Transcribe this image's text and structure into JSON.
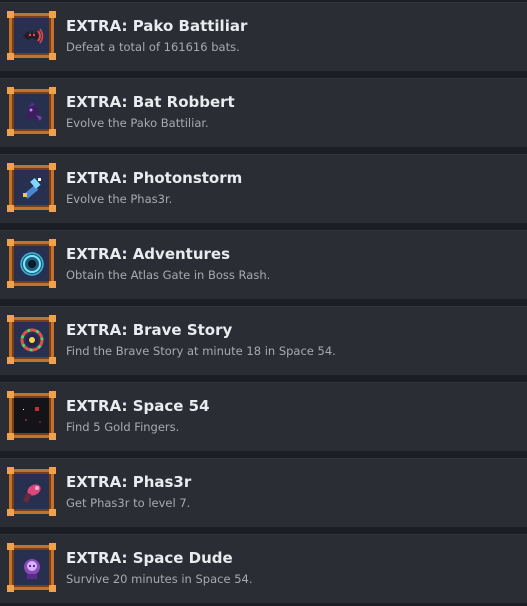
{
  "achievements": [
    {
      "title": "EXTRA: Pako Battiliar",
      "description": "Defeat a total of 161616 bats.",
      "icon": "pako-battiliar-icon"
    },
    {
      "title": "EXTRA: Bat Robbert",
      "description": "Evolve the Pako Battiliar.",
      "icon": "bat-robbert-icon"
    },
    {
      "title": "EXTRA: Photonstorm",
      "description": "Evolve the Phas3r.",
      "icon": "photonstorm-icon"
    },
    {
      "title": "EXTRA: Adventures",
      "description": "Obtain the Atlas Gate in Boss Rash.",
      "icon": "adventures-icon"
    },
    {
      "title": "EXTRA: Brave Story",
      "description": "Find the Brave Story at minute 18 in Space 54.",
      "icon": "brave-story-icon"
    },
    {
      "title": "EXTRA: Space 54",
      "description": "Find 5 Gold Fingers.",
      "icon": "space-54-icon"
    },
    {
      "title": "EXTRA: Phas3r",
      "description": "Get Phas3r to level 7.",
      "icon": "phas3r-icon"
    },
    {
      "title": "EXTRA: Space Dude",
      "description": "Survive 20 minutes in Space 54.",
      "icon": "space-dude-icon"
    }
  ],
  "colors": {
    "row_background": "#2a2d33",
    "page_background": "#1b1e23",
    "title": "#e9ebee",
    "description": "#a7abb1",
    "frame": "#c2722b"
  }
}
